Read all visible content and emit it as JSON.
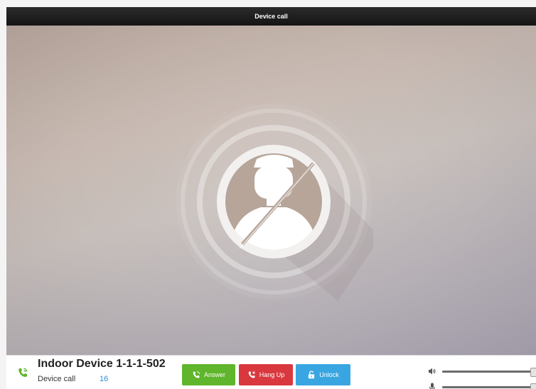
{
  "window": {
    "title": "Device call"
  },
  "call": {
    "device_name": "Indoor Device 1-1-1-502",
    "type_label": "Device call",
    "duration": "16"
  },
  "buttons": {
    "answer": "Answer",
    "hangup": "Hang Up",
    "unlock": "Unlock"
  },
  "audio": {
    "volume_level": 1.0,
    "mic_level": 1.0
  },
  "icons": {
    "call": "phone-ringing-icon",
    "avatar": "no-video-avatar-icon",
    "volume": "speaker-icon",
    "mic": "microphone-icon",
    "unlock": "padlock-open-icon"
  },
  "colors": {
    "answer": "#5fb52b",
    "hangup": "#d9383e",
    "unlock": "#39a6e2",
    "duration_text": "#2a8fd8",
    "titlebar": "#1e1e1e"
  }
}
